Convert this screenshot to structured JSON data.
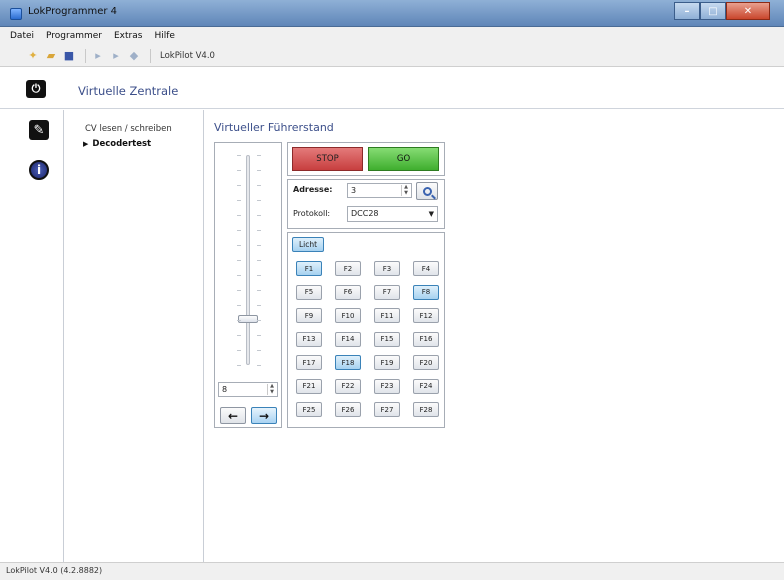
{
  "window": {
    "title": "LokProgrammer 4"
  },
  "menu": {
    "items": [
      "Datei",
      "Programmer",
      "Extras",
      "Hilfe"
    ]
  },
  "toolbar": {
    "device_label": "LokPilot V4.0"
  },
  "header": {
    "title": "Virtuelle Zentrale"
  },
  "nav": {
    "items": [
      {
        "label": "CV lesen / schreiben"
      },
      {
        "label": "Decodertest"
      }
    ]
  },
  "content": {
    "title": "Virtueller Führerstand"
  },
  "controls": {
    "stop_label": "STOP",
    "go_label": "GO",
    "speed_value": "8",
    "speed_fraction": 0.22,
    "address_label": "Adresse:",
    "address_value": "3",
    "protocol_label": "Protokoll:",
    "protocol_value": "DCC28",
    "light_label": "Licht",
    "functions": [
      "F1",
      "F2",
      "F3",
      "F4",
      "F5",
      "F6",
      "F7",
      "F8",
      "F9",
      "F10",
      "F11",
      "F12",
      "F13",
      "F14",
      "F15",
      "F16",
      "F17",
      "F18",
      "F19",
      "F20",
      "F21",
      "F22",
      "F23",
      "F24",
      "F25",
      "F26",
      "F27",
      "F28"
    ],
    "active_functions": [
      "F1",
      "F8",
      "F18"
    ]
  },
  "status": {
    "text": "LokPilot V4.0 (4.2.8882)"
  }
}
